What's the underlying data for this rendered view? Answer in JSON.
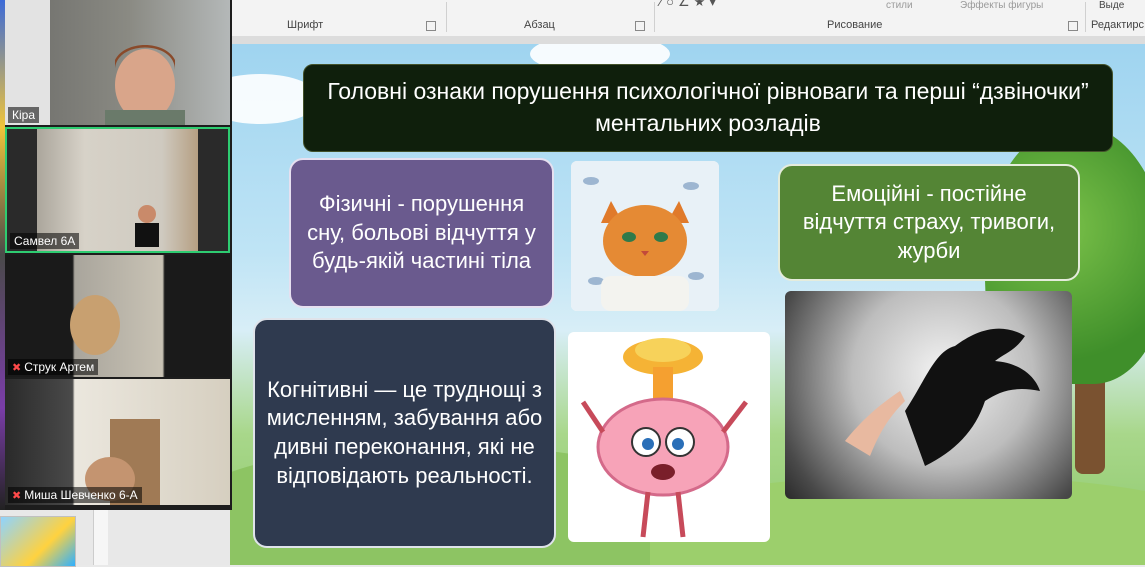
{
  "ribbon": {
    "groups": [
      "Шрифт",
      "Абзац",
      "Рисование",
      "Редактирс"
    ],
    "styles_label": "стили",
    "effects_label": "Эффекты фигуры",
    "select_label": "Выде"
  },
  "slide": {
    "title": "Головні ознаки порушення психологічної рівноваги та перші “дзвіночки” ментальних розладів",
    "physical": "Фізичні  - порушення сну, больові відчуття у будь-якій частині тіла",
    "cognitive": "Когнітивні — це труднощі з мисленням, забування або дивні переконання, які не відповідають реальності.",
    "emotional": "Емоційні  - постійне відчуття страху, тривоги, журби"
  },
  "participants": [
    {
      "name": "Кіра",
      "muted": false
    },
    {
      "name": "Самвел 6А",
      "muted": false
    },
    {
      "name": "Струк Артем",
      "muted": true
    },
    {
      "name": "Миша Шевченко 6-А",
      "muted": true
    }
  ],
  "colors": {
    "active_speaker": "#2ecc71",
    "title_bg": "#0f1f0c",
    "physical_bg": "#6a5a8e",
    "cognitive_bg": "#2f3a4f",
    "emotional_bg": "#548535"
  }
}
